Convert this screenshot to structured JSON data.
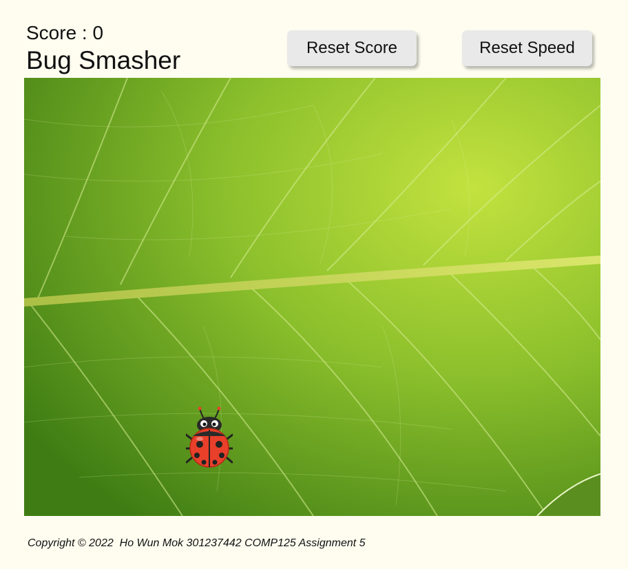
{
  "header": {
    "score_label": "Score : ",
    "score_value": "0",
    "title": "Bug Smasher"
  },
  "buttons": {
    "reset_score": "Reset Score",
    "reset_speed": "Reset Speed"
  },
  "game": {
    "background": "green-leaf-texture",
    "bug": "ladybug-icon",
    "colors": {
      "leaf_light": "#b5dc3a",
      "leaf_dark": "#3f7a12",
      "vein": "#d8ee8c",
      "bug_red": "#e8402a"
    }
  },
  "footer": {
    "copyright": "Copyright © 2022  Ho Wun Mok 301237442 COMP125 Assignment 5"
  }
}
